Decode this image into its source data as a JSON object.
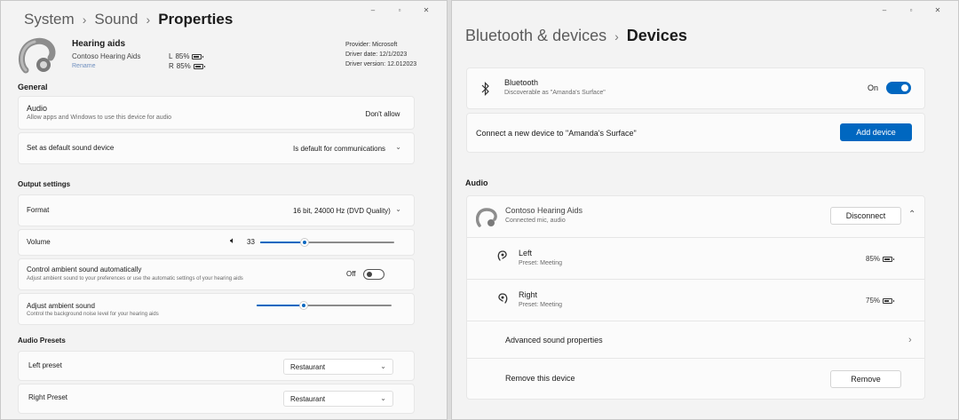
{
  "left": {
    "window_controls": [
      "–",
      "▫",
      "✕"
    ],
    "breadcrumb": {
      "c1": "System",
      "c2": "Sound",
      "current": "Properties"
    },
    "device": {
      "name": "Hearing aids",
      "model": "Contoso Hearing Aids",
      "rename": "Rename",
      "battery_l_label": "L",
      "battery_l": "85%",
      "battery_l_level": 0.85,
      "battery_r_label": "R",
      "battery_r": "85%",
      "battery_r_level": 0.85,
      "provider": "Provider: Microsoft",
      "driver_date": "Driver date: 12/1/2023",
      "driver_version": "Driver version: 12.012023"
    },
    "general": {
      "heading": "General",
      "audio_title": "Audio",
      "audio_desc": "Allow apps and Windows to use this device for audio",
      "audio_action": "Don't allow",
      "default_title": "Set as default sound device",
      "default_value": "Is default for communications"
    },
    "output": {
      "heading": "Output settings",
      "format_title": "Format",
      "format_value": "16 bit, 24000 Hz (DVD Quality)",
      "volume_title": "Volume",
      "volume_value": "33",
      "volume_level": 0.33,
      "ambient_title": "Control ambient sound automatically",
      "ambient_desc": "Adjust ambient sound to your preferences or use the automatic settings of your hearing aids",
      "ambient_state": "Off",
      "adjust_title": "Adjust ambient sound",
      "adjust_desc": "Control the background noise level for your hearing aids",
      "adjust_level": 0.35
    },
    "presets": {
      "heading": "Audio Presets",
      "left_title": "Left preset",
      "left_value": "Restaurant",
      "right_title": "Right Preset",
      "right_value": "Restaurant"
    }
  },
  "right": {
    "window_controls": [
      "–",
      "▫",
      "✕"
    ],
    "breadcrumb": {
      "c1": "Bluetooth & devices",
      "current": "Devices"
    },
    "bluetooth": {
      "title": "Bluetooth",
      "desc": "Discoverable as \"Amanda's Surface\"",
      "state": "On"
    },
    "connect": {
      "text": "Connect a new device to \"Amanda's Surface\"",
      "button": "Add device"
    },
    "audio": {
      "heading": "Audio",
      "device_name": "Contoso Hearing Aids",
      "device_desc": "Connected mic, audio",
      "disconnect": "Disconnect",
      "left_title": "Left",
      "left_desc": "Preset: Meeting",
      "left_battery": "85%",
      "left_level": 0.85,
      "right_title": "Right",
      "right_desc": "Preset: Meeting",
      "right_battery": "75%",
      "right_level": 0.75,
      "advanced": "Advanced sound properties",
      "remove_text": "Remove this device",
      "remove_button": "Remove"
    }
  },
  "colors": {
    "accent": "#0067c0",
    "window_bg": "#f3f3f3",
    "card_bg": "#fbfbfb"
  }
}
